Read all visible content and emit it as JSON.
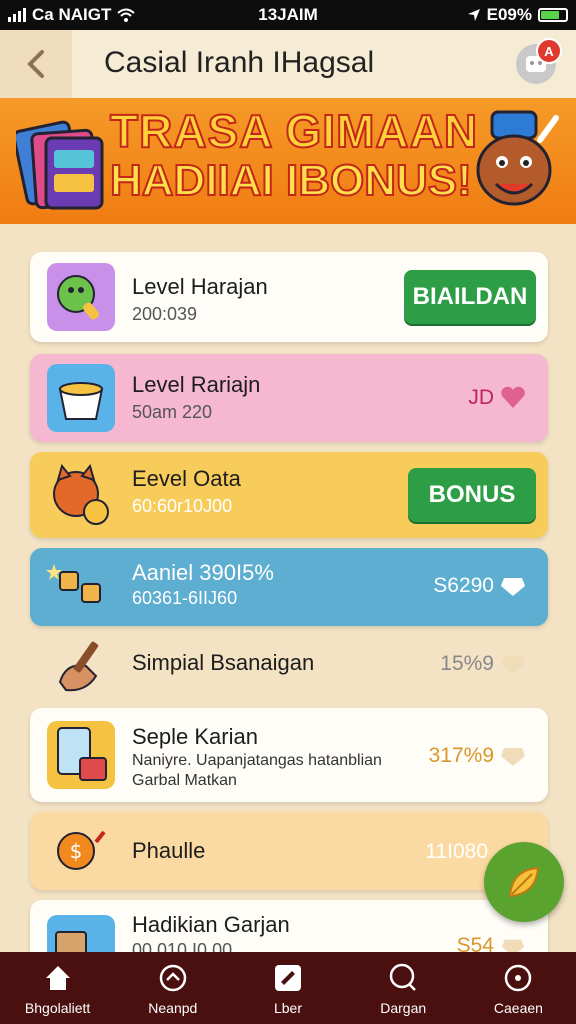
{
  "status": {
    "carrier": "Ca NAIGT",
    "time": "13JAIM",
    "battery": "E09%"
  },
  "header": {
    "title": "Casial Iranh IHagsal",
    "badge": "A"
  },
  "banner": {
    "line1": "TRASA GIMAAN",
    "line2": "HADIIAI IBONUS!"
  },
  "items": [
    {
      "title": "Level Harajan",
      "subtitle": "200:039",
      "button": "BIAILDAN"
    },
    {
      "title": "Level Rariajn",
      "subtitle": "50am 220",
      "value": "JD"
    },
    {
      "title": "Eevel Oata",
      "subtitle": "60:60r10J00",
      "button": "BONUS"
    },
    {
      "title": "Aaniel 390I5%",
      "subtitle": "60361-6IIJ60",
      "value": "S6290"
    },
    {
      "title": "Simpial Bsanaigan",
      "value": "15%9"
    },
    {
      "title": "Seple Karian",
      "subtitle": "Naniyre. Uapanjatangas hatanblian",
      "subtitle2": "Garbal Matkan",
      "value": "317%9"
    },
    {
      "title": "Phaulle",
      "value": "11I080"
    },
    {
      "title": "Hadikian Garjan",
      "subtitle": "00 010 I0 00",
      "value": "S54"
    }
  ],
  "tabs": [
    {
      "label": "Bhgolaliett"
    },
    {
      "label": "Neanpd"
    },
    {
      "label": "Lber"
    },
    {
      "label": "Dargan"
    },
    {
      "label": "Caeaen"
    }
  ],
  "colors": {
    "accent_green": "#2e9e46",
    "banner_orange": "#f07c12",
    "tabbar": "#4a0f0f"
  },
  "icons": [
    "back-arrow-icon",
    "profile-icon",
    "bonus-books-icon",
    "mascot-icon",
    "lollipop-icon",
    "cup-icon",
    "cat-coin-icon",
    "gift-stars-icon",
    "pencil-hand-icon",
    "clipboard-icon",
    "coin-icon",
    "envelope-icon",
    "heart-icon",
    "gem-icon",
    "leaf-icon",
    "home-icon",
    "network-icon",
    "ticket-icon",
    "search-icon",
    "coupon-icon"
  ]
}
